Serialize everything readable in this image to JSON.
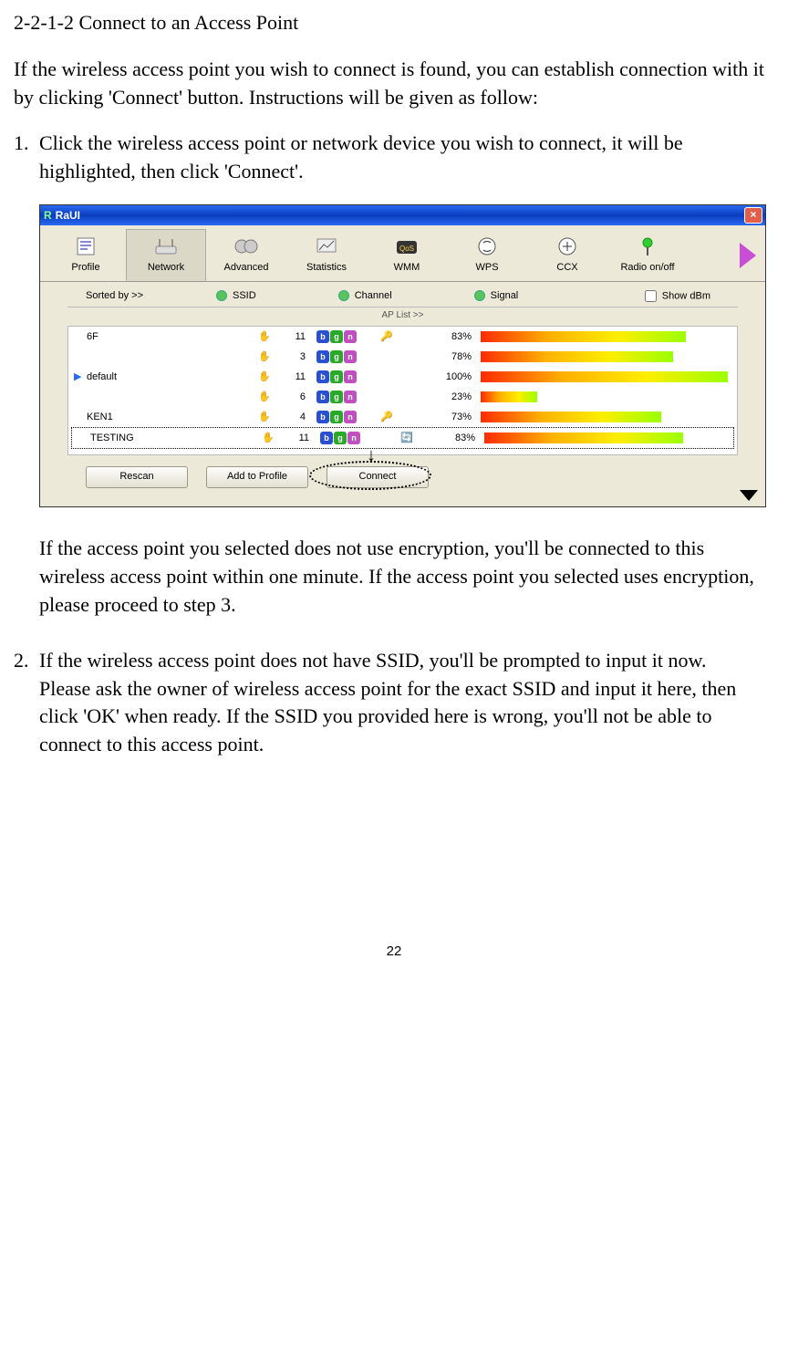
{
  "doc": {
    "section": "2-2-1-2 Connect to an Access Point",
    "intro": "If the wireless access point you wish to connect is found, you can establish connection with it by clicking 'Connect' button. Instructions will be given as follow:",
    "step1_num": "1.",
    "step1": "Click the wireless access point or network device you wish to connect, it will be highlighted, then click 'Connect'.",
    "step1_after": "If the access point you selected does not use encryption, you'll be connected to this wireless access point within one minute. If the access point you selected uses encryption, please proceed to step 3.",
    "step2_num": "2.",
    "step2": "If the wireless access point does not have SSID, you'll be prompted to input it now. Please ask the owner of wireless access point for the exact SSID and input it here, then click 'OK' when ready. If the SSID you provided here is wrong, you'll not be able to connect to this access point.",
    "page": "22"
  },
  "app": {
    "title": "RaUI",
    "tabs": {
      "profile": "Profile",
      "network": "Network",
      "advanced": "Advanced",
      "statistics": "Statistics",
      "wmm": "WMM",
      "wps": "WPS",
      "ccx": "CCX",
      "radio": "Radio on/off"
    },
    "sort": {
      "label": "Sorted by >>",
      "ssid": "SSID",
      "channel": "Channel",
      "signal": "Signal",
      "showdbm": "Show dBm",
      "aplist": "AP List >>"
    },
    "rows": [
      {
        "cur": "",
        "ssid": "6F",
        "ch": "11",
        "lock": true,
        "wps": false,
        "sig": "83%",
        "bar": 83
      },
      {
        "cur": "",
        "ssid": "",
        "ch": "3",
        "lock": false,
        "wps": false,
        "sig": "78%",
        "bar": 78
      },
      {
        "cur": "▶",
        "ssid": "default",
        "ch": "11",
        "lock": false,
        "wps": false,
        "sig": "100%",
        "bar": 100
      },
      {
        "cur": "",
        "ssid": "",
        "ch": "6",
        "lock": false,
        "wps": false,
        "sig": "23%",
        "bar": 23
      },
      {
        "cur": "",
        "ssid": "KEN1",
        "ch": "4",
        "lock": true,
        "wps": false,
        "sig": "73%",
        "bar": 73
      },
      {
        "cur": "",
        "ssid": "TESTING",
        "ch": "11",
        "lock": false,
        "wps": true,
        "sig": "83%",
        "bar": 83
      }
    ],
    "btns": {
      "rescan": "Rescan",
      "add": "Add to Profile",
      "connect": "Connect"
    }
  }
}
